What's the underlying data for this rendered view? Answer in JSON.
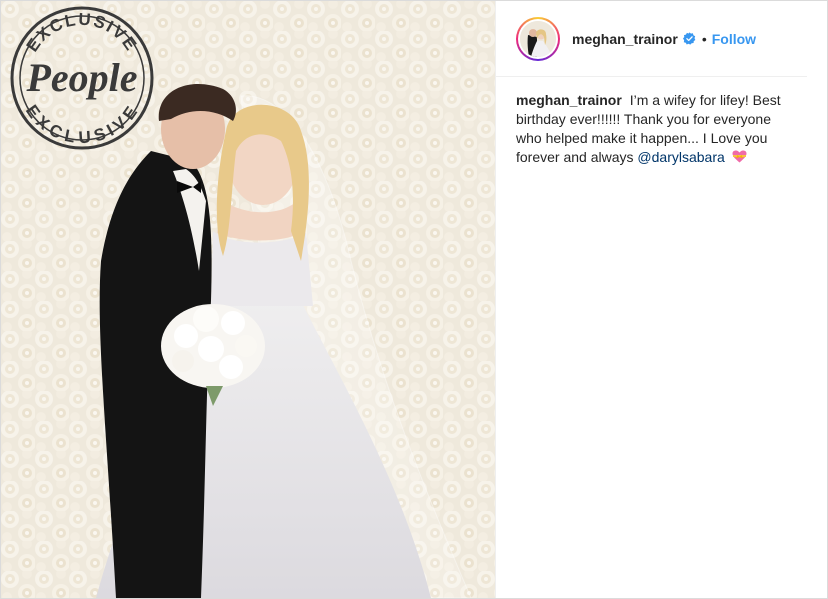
{
  "watermark": {
    "top_text": "EXCLUSIVE",
    "brand_text": "People",
    "bottom_text": "EXCLUSIVE"
  },
  "header": {
    "username": "meghan_trainor",
    "separator": "•",
    "follow_label": "Follow",
    "verified_icon": "verified-badge-icon"
  },
  "caption": {
    "username": "meghan_trainor",
    "text_before_mention": "I’m a wifey for lifey! Best birthday ever!!!!!! Thank you for everyone who helped make it happen... I Love you forever and always",
    "mention": "@darylsabara",
    "emoji": "heart-with-ribbon-icon"
  },
  "colors": {
    "link_blue": "#3897f0",
    "mention_blue": "#003569",
    "text": "#262626",
    "border": "#dbdbdb"
  }
}
